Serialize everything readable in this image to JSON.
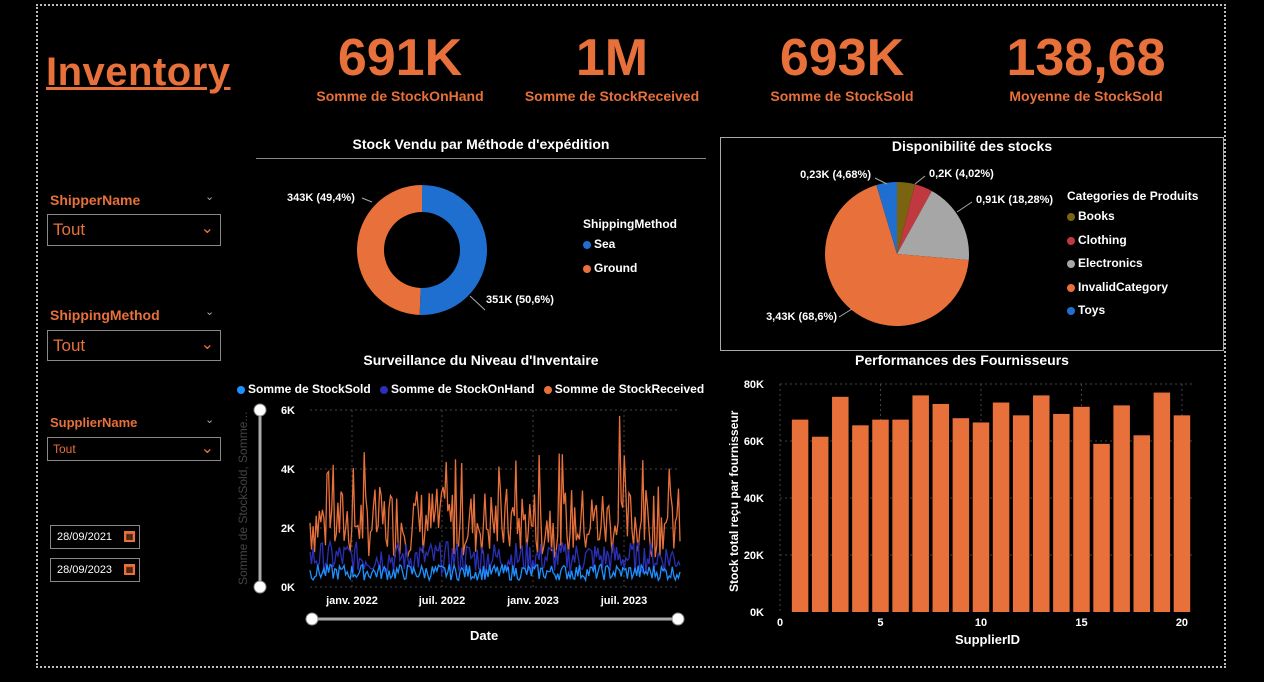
{
  "header": {
    "title": "Inventory"
  },
  "kpis": [
    {
      "value": "691K",
      "label": "Somme de StockOnHand"
    },
    {
      "value": "1M",
      "label": "Somme de StockReceived"
    },
    {
      "value": "693K",
      "label": "Somme de StockSold"
    },
    {
      "value": "138,68",
      "label": "Moyenne de StockSold"
    }
  ],
  "filters": {
    "shipper": {
      "label": "ShipperName",
      "value": "Tout"
    },
    "shipping": {
      "label": "ShippingMethod",
      "value": "Tout"
    },
    "supplier": {
      "label": "SupplierName",
      "value": "Tout"
    },
    "date_start": "28/09/2021",
    "date_end": "28/09/2023"
  },
  "colors": {
    "accent": "#E8703A",
    "blue": "#1F6FD1",
    "navy": "#2A2FB5",
    "lightblue": "#1E90FF"
  },
  "chart_data": [
    {
      "type": "pie",
      "title": "Stock Vendu par Méthode d'expédition",
      "legend_title": "ShippingMethod",
      "labels": [
        "Sea",
        "Ground"
      ],
      "values": [
        351,
        343
      ],
      "data_labels": [
        "351K (50,6%)",
        "343K (49,4%)"
      ],
      "colors": [
        "#1F6FD1",
        "#E8703A"
      ],
      "donut": true
    },
    {
      "type": "pie",
      "title": "Disponibilité des stocks",
      "legend_title": "Categories de Produits",
      "labels": [
        "Books",
        "Clothing",
        "Electronics",
        "InvalidCategory",
        "Toys"
      ],
      "values": [
        0.2,
        0.2,
        0.91,
        3.43,
        0.23
      ],
      "data_labels": [
        "",
        "0,2K (4,02%)",
        "0,91K (18,28%)",
        "3,43K (68,6%)",
        "0,23K (4,68%)"
      ],
      "colors": [
        "#7A6410",
        "#C0393F",
        "#A6A6A6",
        "#E8703A",
        "#1F6FD1"
      ]
    },
    {
      "type": "line",
      "title": "Surveillance du Niveau d'Inventaire",
      "xlabel": "Date",
      "ylabel": "Somme de StockSold, Somme...",
      "x_ticks": [
        "janv. 2022",
        "juil. 2022",
        "janv. 2023",
        "juil. 2023"
      ],
      "y_ticks": [
        "0K",
        "2K",
        "4K",
        "6K"
      ],
      "ylim": [
        0,
        6000
      ],
      "series": [
        {
          "name": "Somme de StockSold",
          "color": "#1E90FF",
          "typical": 500
        },
        {
          "name": "Somme de StockOnHand",
          "color": "#2A2FB5",
          "typical": 1000
        },
        {
          "name": "Somme de StockReceived",
          "color": "#E8703A",
          "typical": 2200,
          "max": 5800
        }
      ]
    },
    {
      "type": "bar",
      "title": "Performances des Fournisseurs",
      "xlabel": "SupplierID",
      "ylabel": "Stock total reçu par fournisseur",
      "x_ticks": [
        "0",
        "5",
        "10",
        "15",
        "20"
      ],
      "y_ticks": [
        "0K",
        "20K",
        "40K",
        "60K",
        "80K"
      ],
      "ylim": [
        0,
        80000
      ],
      "categories": [
        1,
        2,
        3,
        4,
        5,
        6,
        7,
        8,
        9,
        10,
        11,
        12,
        13,
        14,
        15,
        16,
        17,
        18,
        19,
        20
      ],
      "values": [
        67500,
        61500,
        75500,
        65500,
        67500,
        67500,
        76000,
        73000,
        68000,
        66500,
        73500,
        69000,
        76000,
        69500,
        72000,
        59000,
        72500,
        62000,
        77000,
        69000
      ]
    }
  ]
}
